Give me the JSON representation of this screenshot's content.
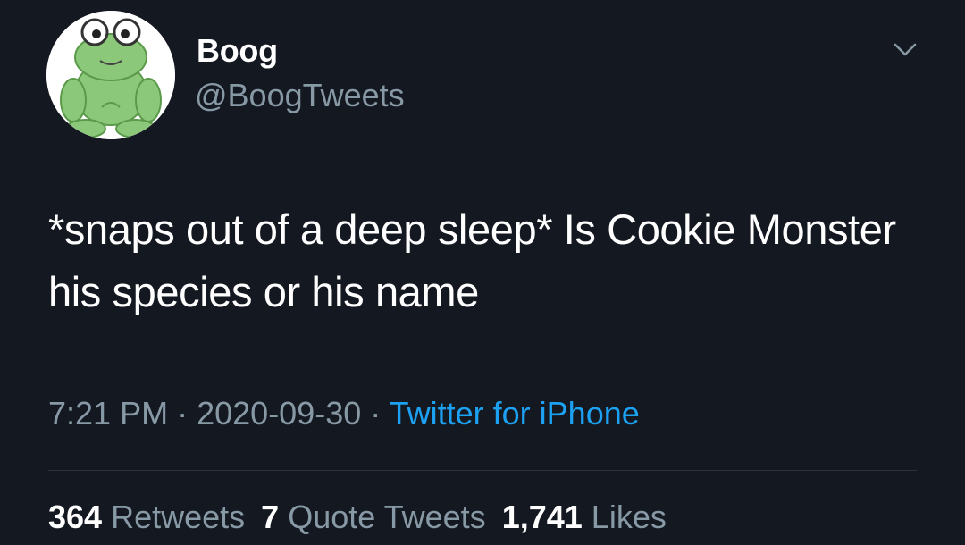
{
  "author": {
    "display_name": "Boog",
    "handle": "@BoogTweets",
    "avatar_icon": "frog-avatar-icon"
  },
  "menu_icon": "chevron-down-icon",
  "tweet": {
    "text": "*snaps out of a deep sleep* Is Cookie Monster his species or his name"
  },
  "meta": {
    "time": "7:21 PM",
    "separator": "·",
    "date": "2020-09-30",
    "source": "Twitter for iPhone"
  },
  "stats": {
    "retweets_count": "364",
    "retweets_label": "Retweets",
    "quotes_count": "7",
    "quotes_label": "Quote Tweets",
    "likes_count": "1,741",
    "likes_label": "Likes"
  },
  "colors": {
    "background": "#141820",
    "text": "#ffffff",
    "secondary": "#8899a6",
    "link": "#1da1f2",
    "frog_green": "#8cc87a"
  }
}
